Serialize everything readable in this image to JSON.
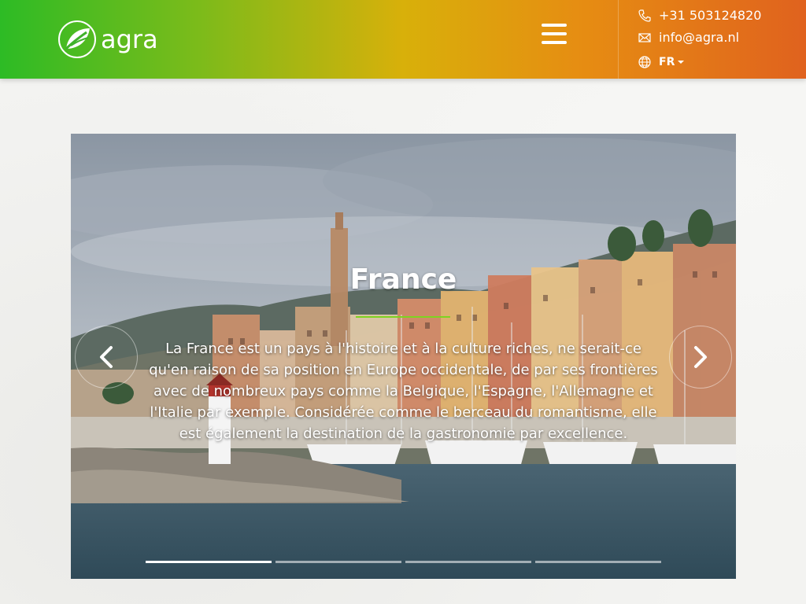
{
  "header": {
    "logo_text": "agra",
    "menu_icon": "hamburger-icon",
    "phone": "+31 503124820",
    "email": "info@agra.nl",
    "language": "FR",
    "colors": {
      "gradient_start": "#2dbb25",
      "gradient_mid": "#d8b00a",
      "gradient_end": "#e0621e"
    }
  },
  "slider": {
    "title": "France",
    "text": "La France est un pays à l'histoire et à la culture riches, ne serait-ce qu'en raison de sa position en Europe occidentale, de par ses frontières avec de nombreux pays comme la Belgique, l'Espagne, l'Allemagne et l'Italie par exemple. Considérée comme le berceau du romantisme, elle est également la destination de la gastronomie par excellence.",
    "prev_icon": "chevron-left-icon",
    "next_icon": "chevron-right-icon",
    "slide_count": 4,
    "active_slide": 1,
    "accent_color": "#7ed321"
  }
}
